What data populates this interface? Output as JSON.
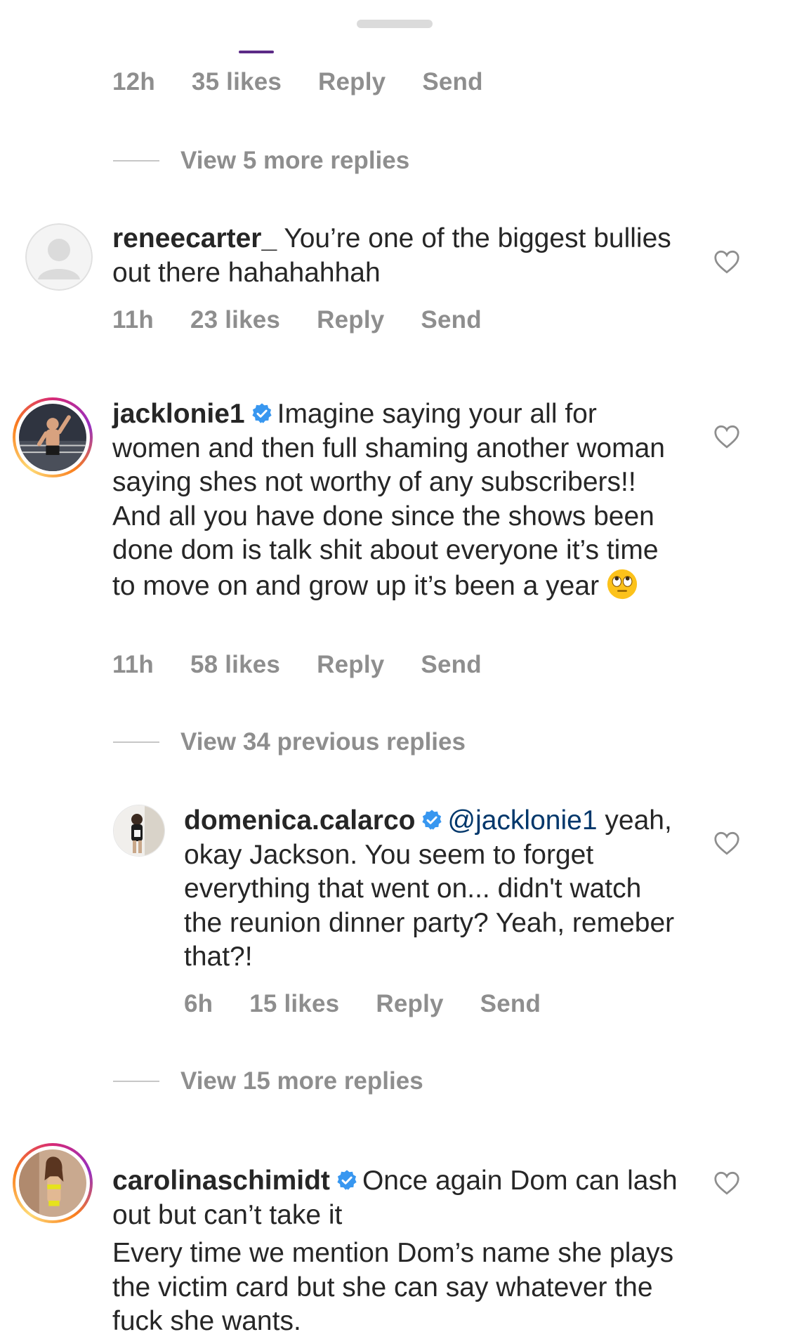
{
  "comments": {
    "c0": {
      "time": "12h",
      "likes": "35 likes",
      "reply": "Reply",
      "send": "Send"
    },
    "view_more_1": "View 5 more replies",
    "c1": {
      "username": "reneecarter_",
      "text": "You’re one of the biggest bullies out there hahahahhah",
      "time": "11h",
      "likes": "23 likes",
      "reply": "Reply",
      "send": "Send"
    },
    "c2": {
      "username": "jacklonie1",
      "text": "Imagine saying your all for women and then full shaming another woman saying shes not worthy of any subscribers!! And all you have done since the shows been done dom is talk shit about everyone it’s time to move on and grow up it’s been a year",
      "emoji": "face-with-rolling-eyes-emoji",
      "time": "11h",
      "likes": "58 likes",
      "reply": "Reply",
      "send": "Send"
    },
    "view_prev_2": "View 34 previous replies",
    "c3": {
      "username": "domenica.calarco",
      "mention": "@jacklonie1",
      "text": "yeah, okay Jackson. You seem to forget everything that went on... didn't watch the reunion dinner party? Yeah, remeber that?!",
      "time": "6h",
      "likes": "15 likes",
      "reply": "Reply",
      "send": "Send"
    },
    "view_more_3": "View 15 more replies",
    "c4": {
      "username": "carolinaschimidt",
      "text": "Once again Dom can lash out but can’t take it",
      "text2": "Every time we mention Dom’s name she plays the victim card but she can say whatever the fuck she wants."
    }
  },
  "colors": {
    "meta_gray": "#8e8e8e",
    "verified_blue": "#3897f0",
    "mention_blue": "#00376b",
    "text": "#262626"
  },
  "icons": [
    "heart-outline-icon",
    "verified-badge-icon",
    "default-avatar-icon"
  ]
}
